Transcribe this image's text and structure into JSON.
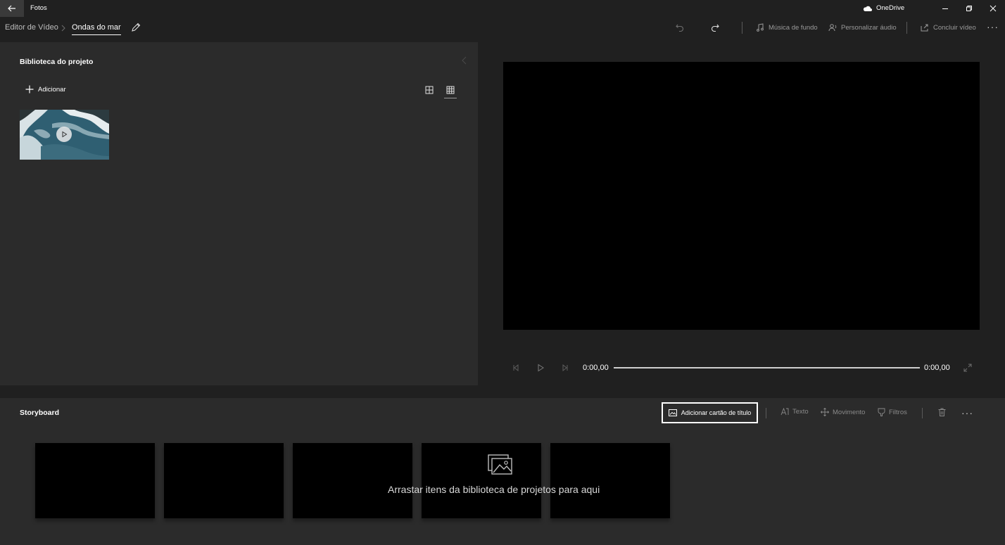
{
  "window": {
    "app_title": "Fotos",
    "onedrive_label": "OneDrive"
  },
  "header": {
    "breadcrumb_root": "Editor de Vídeo",
    "breadcrumb_separator": ">",
    "project_name": "Ondas do mar",
    "background_music": "Música de fundo",
    "custom_audio": "Personalizar áudio",
    "finish_video": "Concluir vídeo",
    "more": "···"
  },
  "library": {
    "title": "Biblioteca do projeto",
    "add_label": "Adicionar"
  },
  "player": {
    "current_time": "0:00,00",
    "total_time": "0:00,00",
    "progress": 0
  },
  "storyboard": {
    "title": "Storyboard",
    "add_title_card": "Adicionar cartão de título",
    "text_tool": "Texto",
    "motion_tool": "Movimento",
    "filters_tool": "Filtros",
    "more": "···",
    "drop_hint": "Arrastar itens da biblioteca de projetos para aqui"
  },
  "colors": {
    "background": "#202020",
    "panel": "#2b2b2b",
    "accent_text": "#ffffff",
    "muted_text": "#9a9a9a"
  },
  "icons": [
    "back-arrow-icon",
    "onedrive-cloud-icon",
    "minimize-icon",
    "restore-icon",
    "close-icon",
    "pencil-icon",
    "undo-icon",
    "redo-icon",
    "music-note-icon",
    "audio-person-icon",
    "export-icon",
    "plus-icon",
    "grid-large-icon",
    "grid-small-icon",
    "play-icon",
    "step-back-icon",
    "step-forward-icon",
    "fullscreen-icon",
    "image-icon",
    "text-icon",
    "motion-icon",
    "filters-icon",
    "trash-icon",
    "photos-icon"
  ]
}
